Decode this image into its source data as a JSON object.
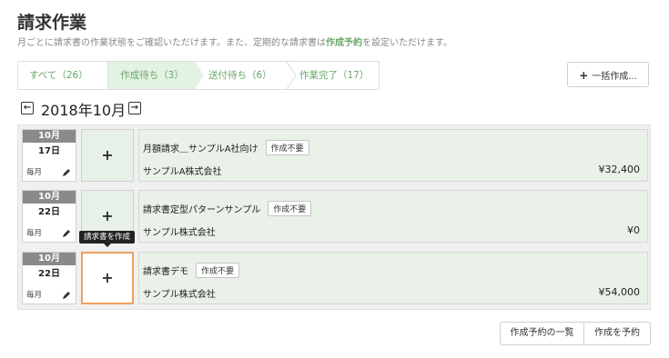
{
  "header": {
    "title": "請求作業",
    "subtitle_before": "月ごとに請求書の作業状態をご確認いただけます。また、定期的な請求書は",
    "subtitle_highlight": "作成予約",
    "subtitle_after": "を設定いただけます。"
  },
  "steps": {
    "all": "すべて（26）",
    "creating": "作成待ち（3）",
    "sending": "送付待ち（6）",
    "done": "作業完了（17）"
  },
  "bulk_create": {
    "plus": "+",
    "label": "一括作成..."
  },
  "month_nav": {
    "prev": "←",
    "label": "2018年10月",
    "next": "→"
  },
  "rows": [
    {
      "month": "10月",
      "day": "17日",
      "frequency": "毎月",
      "plus": "+",
      "name": "月額請求＿サンプルA社向け",
      "badge": "作成不要",
      "company": "サンプルA株式会社",
      "amount": "¥32,400"
    },
    {
      "month": "10月",
      "day": "22日",
      "frequency": "毎月",
      "plus": "+",
      "name": "請求書定型パターンサンプル",
      "badge": "作成不要",
      "company": "サンプル株式会社",
      "amount": "¥0"
    },
    {
      "month": "10月",
      "day": "22日",
      "frequency": "毎月",
      "plus": "+",
      "name": "請求書デモ",
      "badge": "作成不要",
      "company": "サンプル株式会社",
      "amount": "¥54,000"
    }
  ],
  "tooltip": "請求書を作成",
  "footer": {
    "schedule_list": "作成予約の一覧",
    "schedule_create": "作成を予約"
  },
  "colors": {
    "accent_green": "#6aa86a",
    "active_step_bg": "#e4f2e4",
    "highlight_border": "#f0a060"
  }
}
